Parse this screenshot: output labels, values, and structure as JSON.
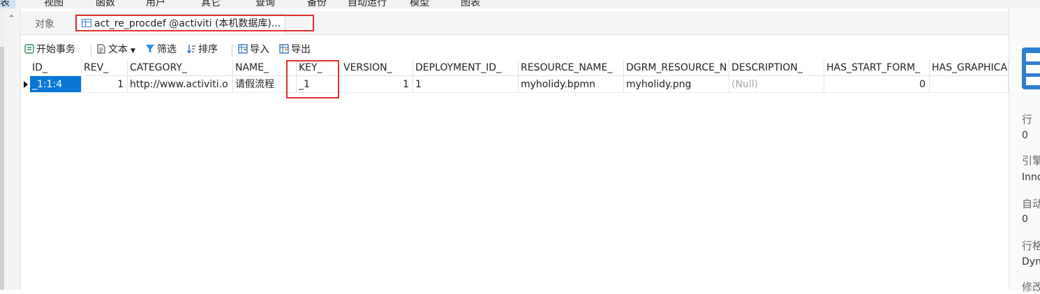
{
  "menubar": {
    "items": [
      "表",
      "视图",
      "函数",
      "用户",
      "其它",
      "查询",
      "备份",
      "自动运行",
      "模型",
      "图表"
    ]
  },
  "tabs": {
    "objects_label": "对象",
    "table_tab_label": "act_re_procdef @activiti (本机数据库)..."
  },
  "toolbar": {
    "begin_transaction": "开始事务",
    "text": "文本",
    "filter": "筛选",
    "sort": "排序",
    "import": "导入",
    "export": "导出"
  },
  "grid": {
    "columns": [
      "ID_",
      "REV_",
      "CATEGORY_",
      "NAME_",
      "KEY_",
      "VERSION_",
      "DEPLOYMENT_ID_",
      "RESOURCE_NAME_",
      "DGRM_RESOURCE_N",
      "DESCRIPTION_",
      "HAS_START_FORM_",
      "HAS_GRAPHICA"
    ],
    "rows": [
      [
        "_1:1:4",
        "1",
        "http://www.activiti.o",
        "请假流程",
        "_1",
        "1",
        "1",
        "myholidy.bpmn",
        "myholidy.png",
        "(Null)",
        "0",
        ""
      ]
    ]
  },
  "right_panel": {
    "rows_label": "行",
    "rows_value": "0",
    "engine_label": "引擎",
    "engine_value": "Inno",
    "autoinc_label": "自动",
    "autoinc_value": "0",
    "rowformat_label": "行格",
    "rowformat_value": "Dyn",
    "modified_label": "修改"
  },
  "colors": {
    "selection": "#0a77d6",
    "highlight_box": "#e0302f",
    "null_text": "#a8a8a8"
  }
}
